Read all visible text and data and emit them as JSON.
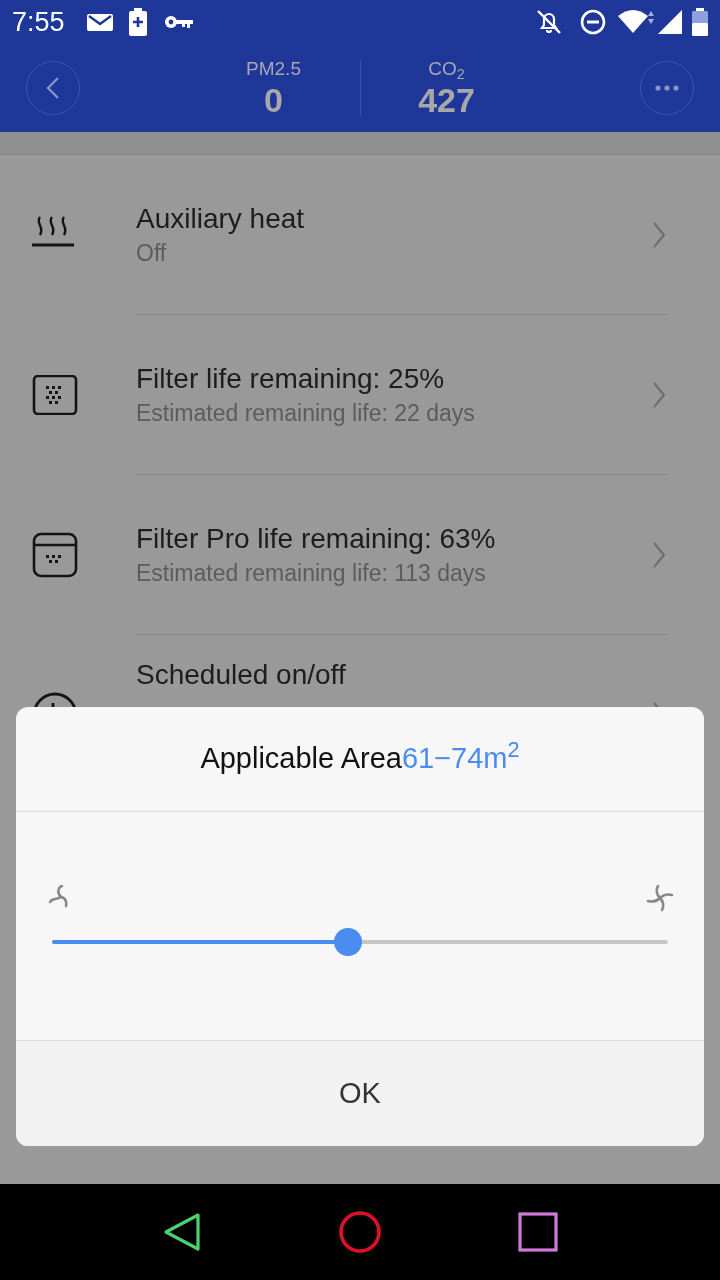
{
  "status_bar": {
    "time": "7:55"
  },
  "header": {
    "metrics": [
      {
        "label": "PM2.5",
        "value": "0"
      },
      {
        "label": "CO$_{2}$",
        "value": "427"
      }
    ]
  },
  "settings": [
    {
      "kind": "heat",
      "title": "Auxiliary heat",
      "subtitle": "Off"
    },
    {
      "kind": "filter",
      "title": "Filter life remaining: 25%",
      "subtitle": "Estimated remaining life: 22 days"
    },
    {
      "kind": "filter-pro",
      "title": "Filter Pro life remaining: 63%",
      "subtitle": "Estimated remaining life: 113 days"
    },
    {
      "kind": "clock",
      "title": "Scheduled on/off"
    }
  ],
  "dialog": {
    "title": "Applicable Area",
    "area": "61−74m$^{2}$",
    "slider": {
      "level": 0.48
    },
    "button": "OK"
  }
}
